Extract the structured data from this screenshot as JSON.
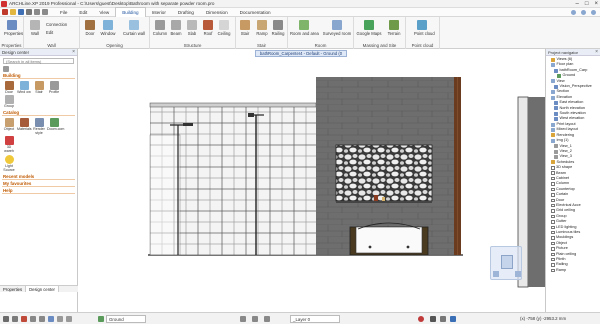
{
  "window": {
    "title": "ARCHLine.XP 2019  Professional  -  C:\\Users\\guest\\Desktop\\Bathroom with separate powder room.pro"
  },
  "menu": {
    "tabs": [
      "File",
      "Edit",
      "View",
      "Building",
      "Interior",
      "Drafting",
      "Dimension",
      "Documentation"
    ],
    "active": "Building"
  },
  "ribbon": {
    "groups": [
      {
        "label": "Properties",
        "buttons": [
          "Properties"
        ]
      },
      {
        "label": "Wall",
        "buttons": [
          "Wall",
          "Connection",
          "Edit"
        ]
      },
      {
        "label": "Opening",
        "buttons": [
          "Door",
          "Window",
          "Curtain wall"
        ]
      },
      {
        "label": "Structure",
        "buttons": [
          "Column",
          "Beam",
          "Slab",
          "Roof",
          "Ceiling"
        ]
      },
      {
        "label": "Stair",
        "buttons": [
          "Stair",
          "Ramp",
          "Railing"
        ]
      },
      {
        "label": "Room",
        "buttons": [
          "Room and area",
          "Surveyed room"
        ]
      },
      {
        "label": "Massing and Site",
        "buttons": [
          "Google Maps",
          "Terrain"
        ]
      },
      {
        "label": "Point cloud",
        "buttons": [
          "Point cloud"
        ]
      }
    ]
  },
  "document_tab": "bathRoom_Carpenter4 - Default - Ground (0 mm) *",
  "design_center": {
    "title": "Design center",
    "search_placeholder": "(Search in all items)",
    "sections": [
      {
        "name": "Building",
        "items": [
          "Door",
          "Wind ow",
          "Stair",
          "Profile",
          "Group"
        ]
      },
      {
        "name": "Catalog",
        "items": [
          "Object",
          "Materials",
          "Render style",
          "Doom.com",
          "3D wareh"
        ]
      },
      {
        "name": "",
        "items": [
          "Light Source"
        ]
      }
    ],
    "links": [
      "Recent models",
      "My favourites",
      "Help"
    ],
    "bottom_tabs": [
      "Properties",
      "Design center"
    ]
  },
  "project_navigator": {
    "title": "Project navigator",
    "items": [
      "Views (6)",
      "Floor plan",
      "bathRoom_Carp",
      "Ground",
      "View",
      "Vision_Perspective",
      "Section",
      "Elevation",
      "East elevation",
      "North elevation",
      "South elevation",
      "West elevation",
      "Print layout",
      "Mixed layout",
      "Rendering",
      "Img (1)",
      "View_1",
      "View_2",
      "View_3",
      "Schedules",
      "3D shape",
      "Beam",
      "Cabinet",
      "Column",
      "Countertop",
      "Curtain",
      "Door",
      "Electrical Acce",
      "Grid ceiling",
      "Group",
      "Gutter",
      "LED lighting",
      "Luminous tiles",
      "Mouldings",
      "Object",
      "Picture",
      "Plain ceiling",
      "Plinth",
      "Railing",
      "Ramp"
    ]
  },
  "status": {
    "floor": "Ground",
    "layer": "_Layer 0",
    "coords": "(x) -758   (y) -2953.2 mm"
  },
  "colors": {
    "accent": "#1a4f9c",
    "brick_wall": "#6e6e6e",
    "tile_grid": "#ffffff",
    "brown_trim": "#6b3b20"
  }
}
